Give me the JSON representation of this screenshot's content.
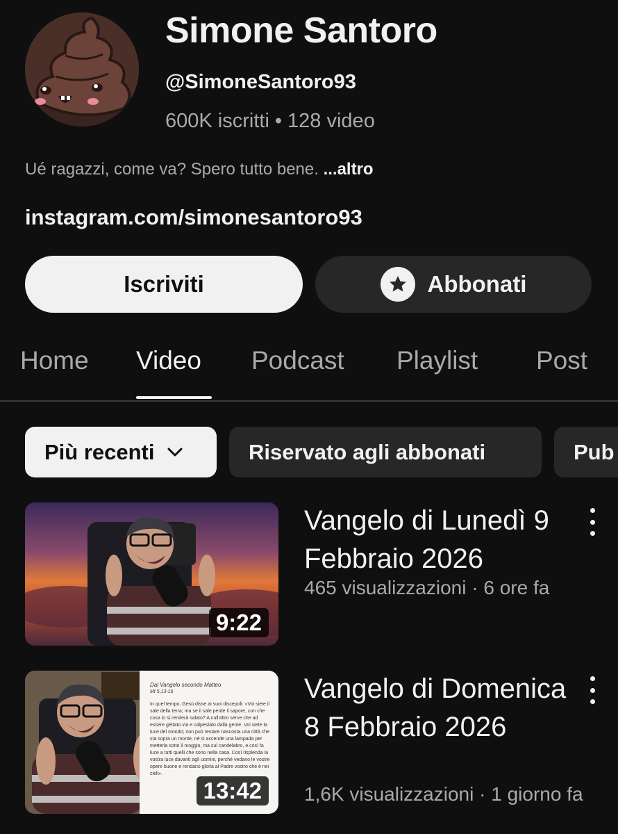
{
  "channel": {
    "name": "Simone Santoro",
    "handle": "@SimoneSantoro93",
    "subscribers": "600K iscritti",
    "separator": "•",
    "video_count": "128 video",
    "description": "Ué ragazzi, come va? Spero tutto bene.",
    "description_more": "...altro",
    "link": "instagram.com/simonesantoro93",
    "avatar_icon": "poop-mascot-avatar"
  },
  "buttons": {
    "subscribe": "Iscriviti",
    "join": "Abbonati",
    "join_icon": "star-badge-icon"
  },
  "tabs": [
    {
      "label": "Home",
      "active": false
    },
    {
      "label": "Video",
      "active": true
    },
    {
      "label": "Podcast",
      "active": false
    },
    {
      "label": "Playlist",
      "active": false
    },
    {
      "label": "Post",
      "active": false
    }
  ],
  "chips": {
    "sort": "Più recenti",
    "members": "Riservato agli abbonati",
    "public": "Pub"
  },
  "videos": [
    {
      "title": "Vangelo di Lunedì 9 Febbraio 2026",
      "meta": "465 visualizzazioni · 6 ore fa",
      "duration": "9:22"
    },
    {
      "title": "Vangelo di Domenica 8 Febbraio 2026",
      "meta": "1,6K visualizzazioni · 1 giorno fa",
      "duration": "13:42",
      "thumb_heading": "Dal Vangelo secondo Matteo",
      "thumb_ref": "Mt 5,13-16",
      "thumb_body": "In quel tempo, Gesù disse ai suoi discepoli: «Voi siete il sale della terra; ma se il sale perde il sapore, con che cosa lo si renderà salato? A null'altro serve che ad essere gettato via e calpestato dalla gente. Voi siete la luce del mondo; non può restare nascosta una città che sta sopra un monte, né si accende una lampada per metterla sotto il moggio, ma sul candelabro, e così fa luce a tutti quelli che sono nella casa. Così risplenda la vostra luce davanti agli uomini, perché vedano le vostre opere buone e rendano gloria al Padre vostro che è nei cieli»."
    }
  ],
  "colors": {
    "background": "#0f0f0f",
    "text_primary": "#f1f1f1",
    "text_secondary": "#aaaaaa",
    "chip_dark": "#272727"
  }
}
